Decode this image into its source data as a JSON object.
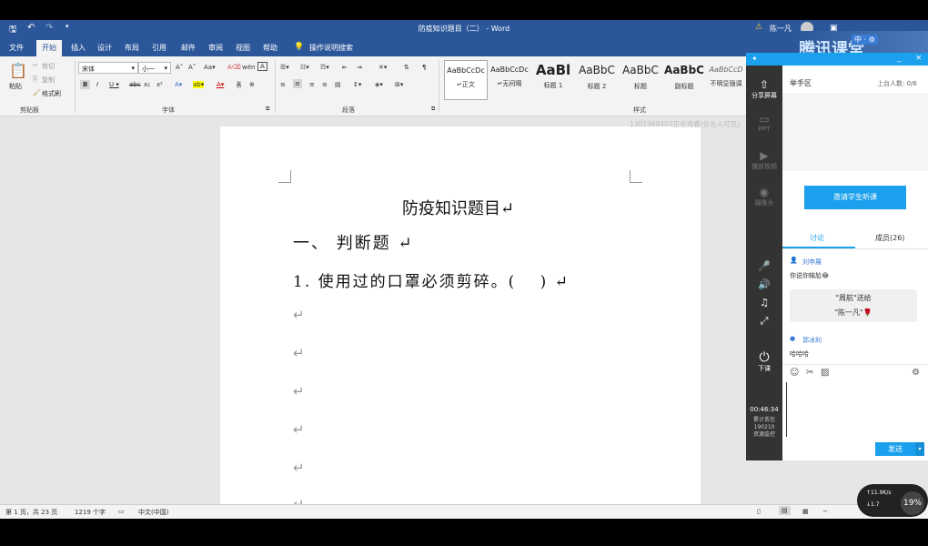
{
  "word": {
    "title": "防疫知识题目（二） - Word",
    "user": "陈一凡",
    "tabs": [
      "文件",
      "开始",
      "插入",
      "设计",
      "布局",
      "引用",
      "邮件",
      "审阅",
      "视图",
      "帮助"
    ],
    "tell_me": "操作说明搜索",
    "clipboard": {
      "paste": "粘贴",
      "cut": "剪切",
      "copy": "复制",
      "format_painter": "格式刷",
      "label": "剪贴板"
    },
    "font": {
      "name": "宋体",
      "size": "小一",
      "label": "字体"
    },
    "paragraph_label": "段落",
    "styles": {
      "label": "样式",
      "items": [
        {
          "sample": "AaBbCcDc",
          "name": "↵正文"
        },
        {
          "sample": "AaBbCcDc",
          "name": "↵无间隔"
        },
        {
          "sample": "AaBl",
          "name": "标题 1"
        },
        {
          "sample": "AaBbC",
          "name": "标题 2"
        },
        {
          "sample": "AaBbC",
          "name": "标题"
        },
        {
          "sample": "AaBbC",
          "name": "副标题"
        },
        {
          "sample": "AaBbCcD",
          "name": "不明显强调"
        }
      ]
    },
    "document": {
      "title": "防疫知识题目↵",
      "section": "一、 判断题 ↵",
      "question1": "1. 使用过的口罩必须剪碎。(　 ) ↵",
      "para_mark": "↵"
    },
    "status": {
      "page": "第 1 页，共 23 页",
      "words": "1219 个字",
      "lang": "中文(中国)"
    }
  },
  "classroom": {
    "logo": "腾讯课堂",
    "badge": "中 · ⚙",
    "viewer_note": "1301968402正在观看(仅名人可见)",
    "side": [
      {
        "icon": "⇧",
        "label": "分享屏幕",
        "icon_name": "share-screen-icon"
      },
      {
        "icon": "▭",
        "label": "PPT",
        "icon_name": "ppt-icon"
      },
      {
        "icon": "▶",
        "label": "播放视频",
        "icon_name": "play-video-icon"
      },
      {
        "icon": "◉",
        "label": "摄像头",
        "icon_name": "camera-icon"
      }
    ],
    "end_class": "下课",
    "timer": "00:46:34",
    "gift_stats": "累计丢包\n190210\n资源监控",
    "raise_hand": "举手区",
    "online": "上台人数: 0/6",
    "invite": "邀请学生听课",
    "tabs": {
      "discuss": "讨论",
      "members": "成员(26)"
    },
    "messages": [
      {
        "user": "刘申展",
        "text": "你说你输尬😂"
      },
      {
        "user": "",
        "text": "\"周航\"送给\n\"陈一凡\"🌹"
      },
      {
        "user": "郭冰利",
        "text": "哈哈哈"
      }
    ],
    "send": "发送",
    "speed_up": "↑11.9K/s",
    "speed_down": "↓1.7",
    "percent": "19%"
  }
}
